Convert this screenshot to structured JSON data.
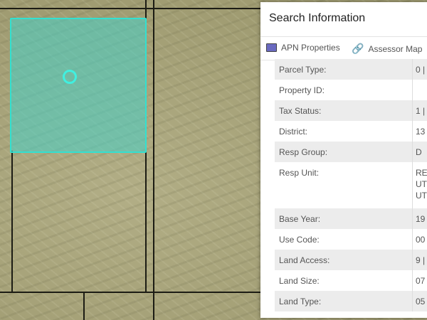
{
  "panel": {
    "title": "Search Information",
    "tabs": [
      {
        "label": "APN Properties",
        "icon": "monitor-icon"
      },
      {
        "label": "Assessor Map",
        "icon": "link-icon"
      }
    ]
  },
  "rows": [
    {
      "label": "Parcel Type:",
      "value": "0 |"
    },
    {
      "label": "Property ID:",
      "value": ""
    },
    {
      "label": "Tax Status:",
      "value": "1 |"
    },
    {
      "label": "District:",
      "value": "13"
    },
    {
      "label": "Resp Group:",
      "value": "D"
    },
    {
      "label": "Resp Unit:",
      "value": "RE\nUT\nUT"
    },
    {
      "label": "Base Year:",
      "value": "19"
    },
    {
      "label": "Use Code:",
      "value": "00"
    },
    {
      "label": "Land Access:",
      "value": "9 |"
    },
    {
      "label": "Land Size:",
      "value": "07"
    },
    {
      "label": "Land Type:",
      "value": "05"
    }
  ],
  "colors": {
    "selection": "#46d2c8",
    "accent": "#2b7bd6"
  }
}
